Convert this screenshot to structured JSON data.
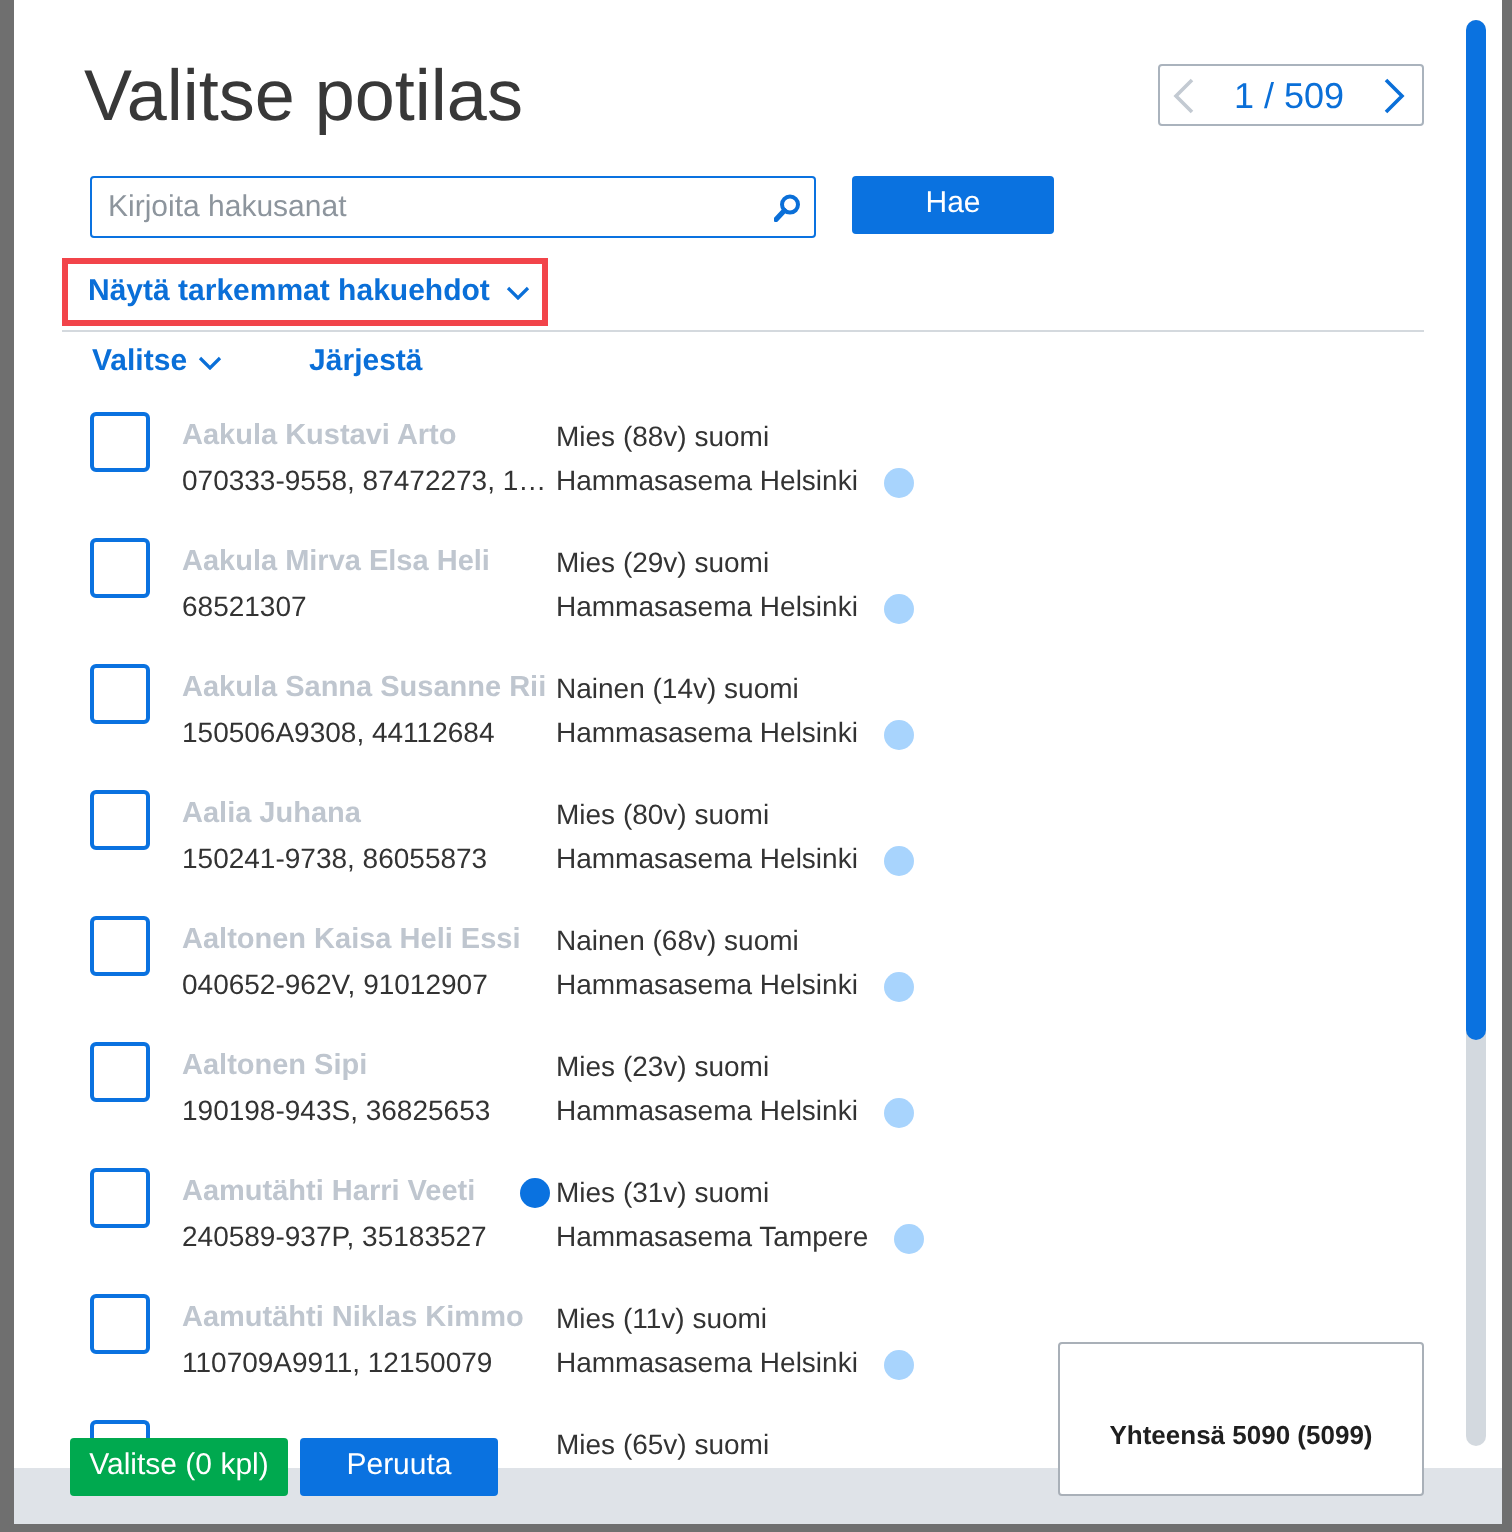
{
  "title": "Valitse potilas",
  "pager": {
    "page": "1 / 509",
    "prev_disabled": true,
    "next_disabled": false
  },
  "search": {
    "placeholder": "Kirjoita hakusanat",
    "button": "Hae"
  },
  "advanced_search": {
    "label": "Näytä tarkemmat hakuehdot",
    "highlighted": true
  },
  "toolbar": [
    {
      "label": "Valitse",
      "kind": "dropdown"
    },
    {
      "label": "Järjestä",
      "kind": "link"
    }
  ],
  "patients": [
    {
      "name": "Aakula Kustavi Arto",
      "ids": "070333-9558, 87472273, 1…",
      "details": "Mies (88v) suomi",
      "location": "Hammasasema Helsinki",
      "marked": false,
      "checked": false
    },
    {
      "name": "Aakula Mirva Elsa Heli",
      "ids": "68521307",
      "details": "Mies (29v) suomi",
      "location": "Hammasasema Helsinki",
      "marked": false,
      "checked": false
    },
    {
      "name": "Aakula Sanna Susanne Rii",
      "ids": "150506A9308, 44112684",
      "details": "Nainen (14v) suomi",
      "location": "Hammasasema Helsinki",
      "marked": false,
      "checked": false
    },
    {
      "name": "Aalia Juhana",
      "ids": "150241-9738, 86055873",
      "details": "Mies (80v) suomi",
      "location": "Hammasasema Helsinki",
      "marked": false,
      "checked": false
    },
    {
      "name": "Aaltonen Kaisa Heli Essi",
      "ids": "040652-962V, 91012907",
      "details": "Nainen (68v) suomi",
      "location": "Hammasasema Helsinki",
      "marked": false,
      "checked": false
    },
    {
      "name": "Aaltonen Sipi",
      "ids": "190198-943S, 36825653",
      "details": "Mies (23v) suomi",
      "location": "Hammasasema Helsinki",
      "marked": false,
      "checked": false
    },
    {
      "name": "Aamutähti Harri Veeti",
      "ids": "240589-937P, 35183527",
      "details": "Mies (31v) suomi",
      "location": "Hammasasema Tampere",
      "marked": true,
      "checked": false
    },
    {
      "name": "Aamutähti Niklas Kimmo",
      "ids": "110709A9911, 12150079",
      "details": "Mies (11v) suomi",
      "location": "Hammasasema Helsinki",
      "marked": false,
      "checked": false
    },
    {
      "details": "Mies (65v) suomi",
      "marked": false,
      "checked": false
    }
  ],
  "footer": {
    "buttons": [
      {
        "label": "Valitse (0 kpl)",
        "kind": "confirm"
      },
      {
        "label": "Peruuta",
        "kind": "cancel"
      }
    ],
    "total": "Yhteensä 5090 (5099)"
  }
}
